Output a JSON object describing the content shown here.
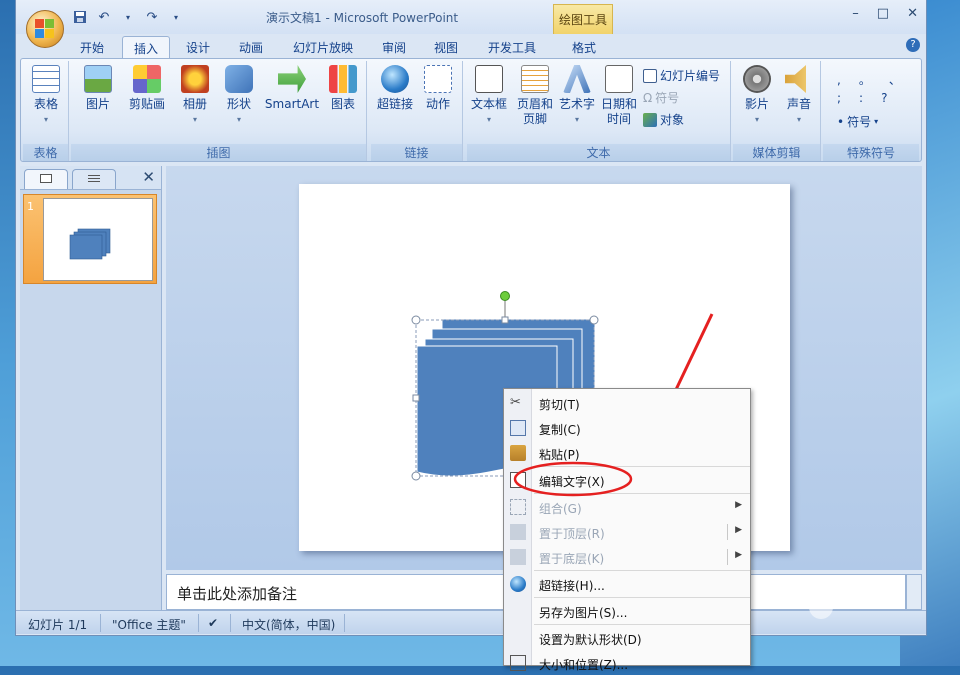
{
  "window": {
    "title": "演示文稿1 - Microsoft PowerPoint",
    "context_tab_title": "绘图工具"
  },
  "window_controls": {
    "minimize": "–",
    "maximize": "□",
    "close": "✕"
  },
  "tabs": [
    "开始",
    "插入",
    "设计",
    "动画",
    "幻灯片放映",
    "审阅",
    "视图",
    "开发工具",
    "格式"
  ],
  "active_tab": "插入",
  "ribbon": {
    "groups": {
      "tables": {
        "label": "表格",
        "buttons": [
          "表格"
        ]
      },
      "illustrations": {
        "label": "插图",
        "buttons": [
          "图片",
          "剪贴画",
          "相册",
          "形状",
          "SmartArt",
          "图表"
        ]
      },
      "links": {
        "label": "链接",
        "buttons": [
          "超链接",
          "动作"
        ]
      },
      "text": {
        "label": "文本",
        "buttons": [
          "文本框",
          "页眉和",
          "页脚",
          "艺术字",
          "日期和",
          "时间"
        ],
        "small": [
          "幻灯片编号",
          "符号",
          "对象"
        ]
      },
      "media": {
        "label": "媒体剪辑",
        "buttons": [
          "影片",
          "声音"
        ]
      },
      "special": {
        "label": "特殊符号",
        "symbols": [
          ",",
          "。",
          "、",
          ";",
          ":",
          "?"
        ],
        "button": "符号"
      }
    }
  },
  "panel": {
    "slide_number": "1",
    "close": "✕"
  },
  "notes_placeholder": "单击此处添加备注",
  "status": {
    "slide": "幻灯片 1/1",
    "theme": "\"Office 主题\"",
    "language": "中文(简体，中国)"
  },
  "context_menu": {
    "items": [
      "剪切(T)",
      "复制(C)",
      "粘贴(P)",
      "编辑文字(X)",
      "组合(G)",
      "置于顶层(R)",
      "置于底层(K)",
      "超链接(H)...",
      "另存为图片(S)...",
      "设置为默认形状(D)",
      "大小和位置(Z)..."
    ]
  },
  "colors": {
    "accent": "#15428b",
    "shape_fill": "#4f81bd",
    "annotation": "#e52020",
    "handle": "#6ccd3c"
  }
}
